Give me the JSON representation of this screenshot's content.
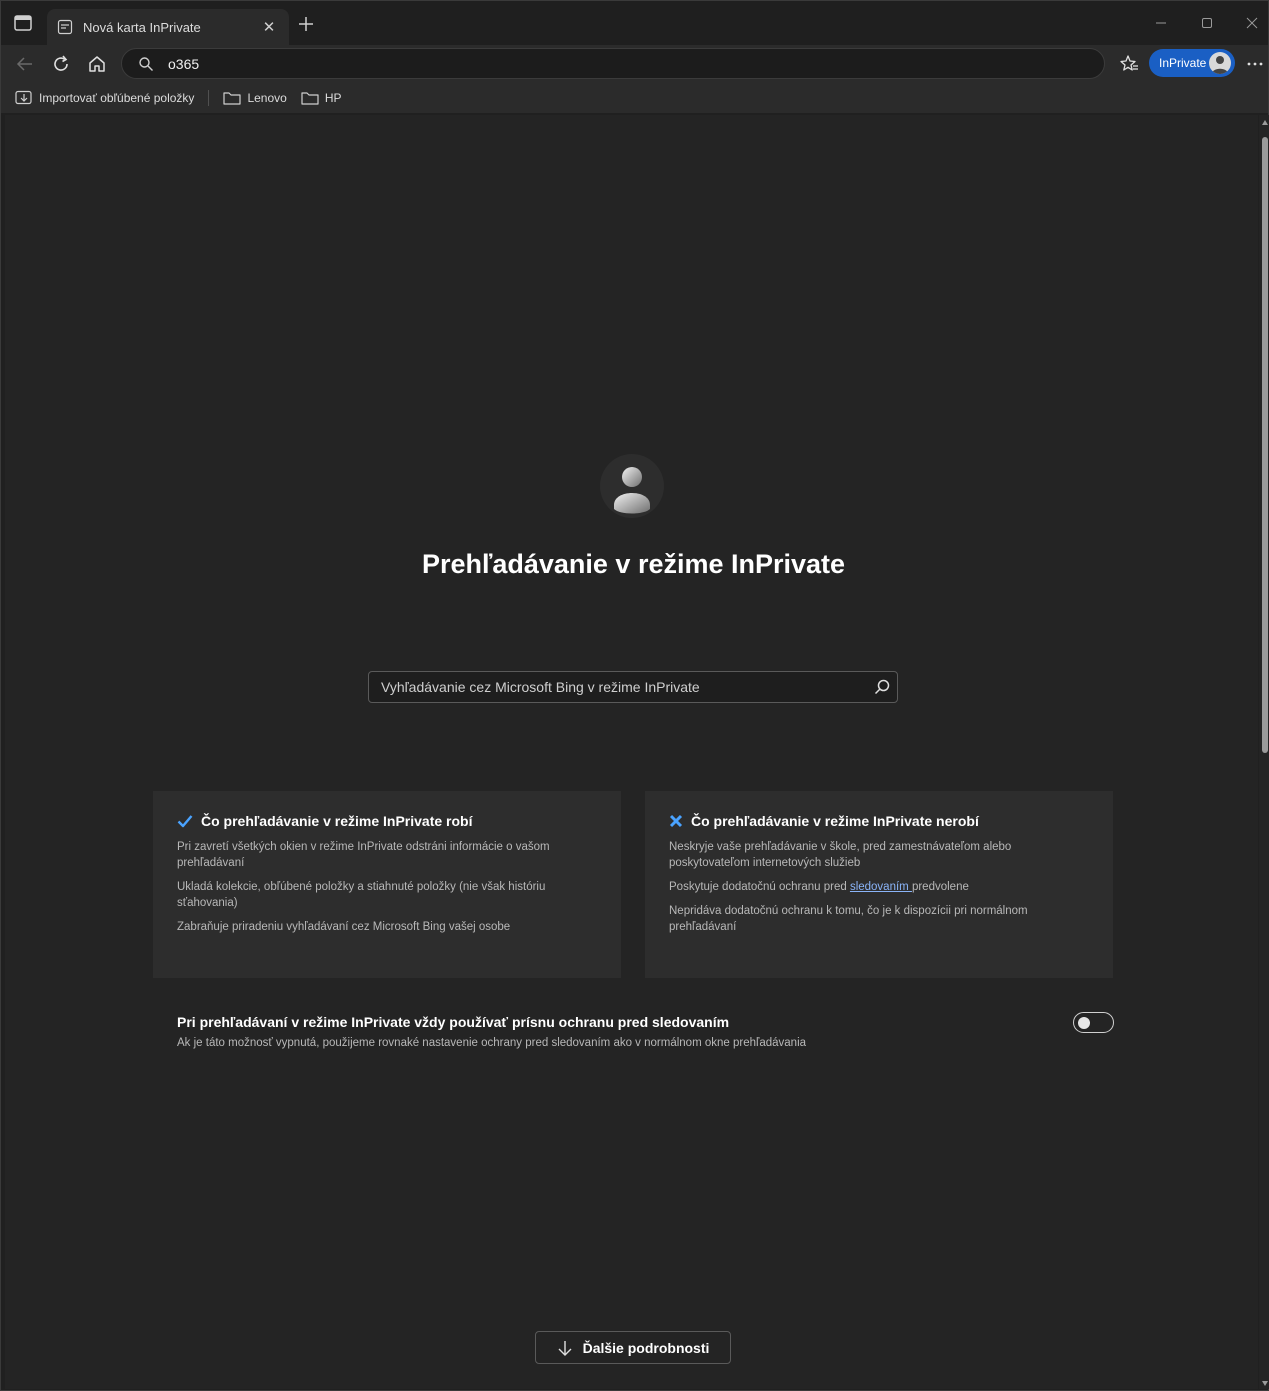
{
  "tab": {
    "title": "Nová karta InPrivate"
  },
  "address": {
    "value": "o365"
  },
  "toolbar": {
    "inprivate_label": "InPrivate"
  },
  "favorites": [
    {
      "label": "Importovať obľúbené položky",
      "icon": "import-favorites-icon"
    },
    {
      "label": "Lenovo",
      "icon": "folder-icon"
    },
    {
      "label": "HP",
      "icon": "folder-icon"
    }
  ],
  "page": {
    "title": "Prehľadávanie v režime InPrivate",
    "search_placeholder": "Vyhľadávanie cez Microsoft Bing v režime InPrivate",
    "does": {
      "heading": "Čo prehľadávanie v režime InPrivate robí",
      "items": [
        "Pri zavretí všetkých okien v režime InPrivate odstráni informácie o vašom prehľadávaní",
        "Ukladá kolekcie, obľúbené položky a stiahnuté položky (nie však históriu sťahovania)",
        "Zabraňuje priradeniu vyhľadávaní cez Microsoft Bing vašej osobe"
      ]
    },
    "does_not": {
      "heading": "Čo prehľadávanie v režime InPrivate nerobí",
      "item1": "Neskryje vaše prehľadávanie v škole, pred zamestnávateľom alebo poskytovateľom internetových služieb",
      "item2_prefix": "Poskytuje dodatočnú ochranu pred ",
      "item2_link": "sledovaním ",
      "item2_suffix": "predvolene",
      "item3": "Nepridáva dodatočnú ochranu k tomu, čo je k dispozícii pri normálnom prehľadávaní"
    },
    "setting": {
      "title": "Pri prehľadávaní v režime InPrivate vždy používať prísnu ochranu pred sledovaním",
      "description": "Ak je táto možnosť vypnutá, použijeme rovnaké nastavenie ochrany pred sledovaním ako v normálnom okne prehľadávania",
      "enabled": false
    },
    "more_button": "Ďalšie podrobnosti"
  },
  "colors": {
    "accent": "#1a5fc4",
    "check": "#4aa3ff",
    "cross": "#4aa3ff",
    "link": "#8ab4f8"
  }
}
